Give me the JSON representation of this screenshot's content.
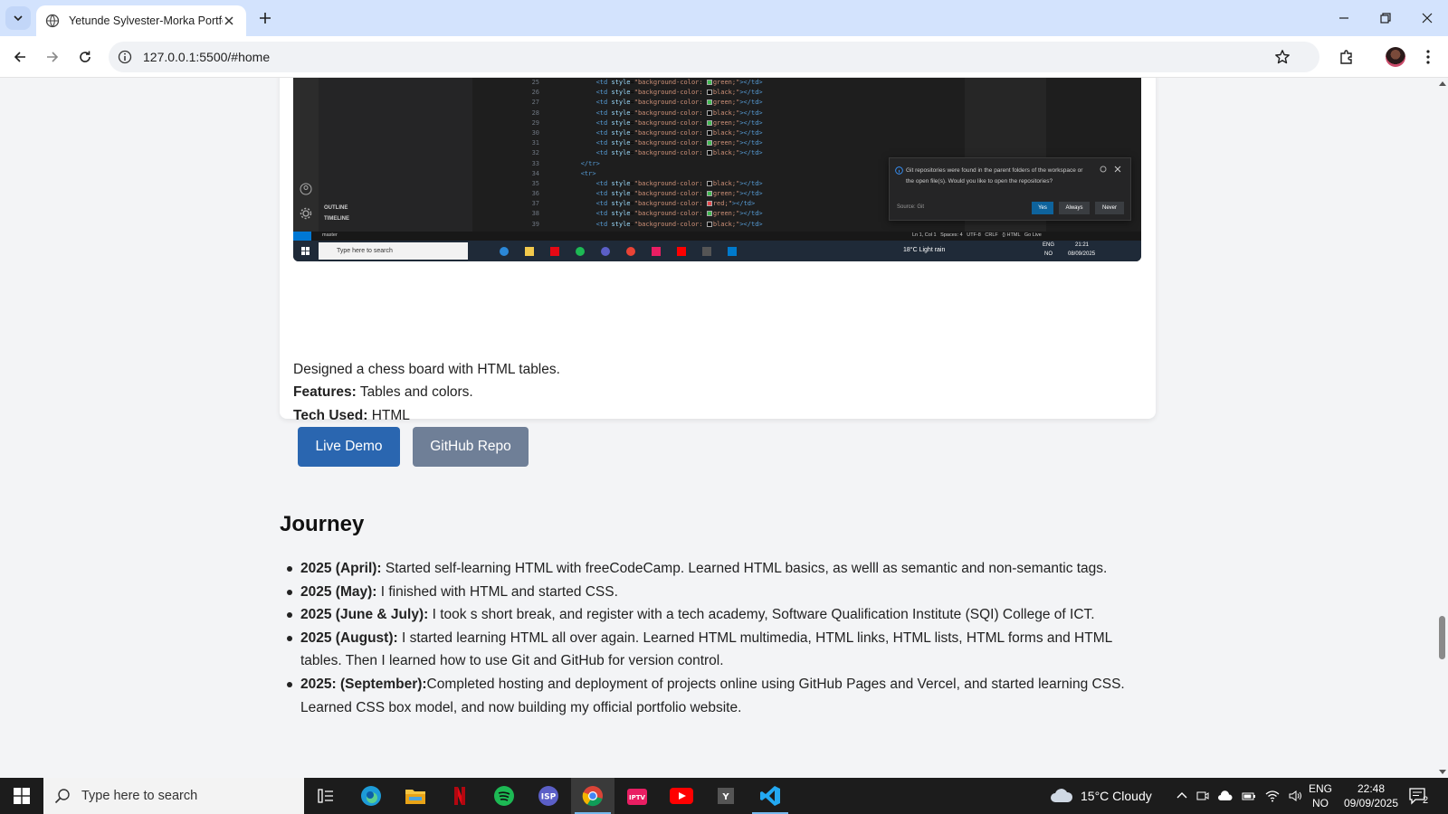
{
  "browser": {
    "tab_title": "Yetunde Sylvester-Morka Portfolio",
    "url": "127.0.0.1:5500/#home"
  },
  "project": {
    "description": "Designed a chess board with HTML tables.",
    "features_label": "Features:",
    "features_value": "Tables and colors.",
    "tech_label": "Tech Used:",
    "tech_value": "HTML",
    "live_demo_label": "Live Demo",
    "github_repo_label": "GitHub Repo"
  },
  "embedded_screenshot": {
    "code_lines": [
      {
        "n": "25",
        "color": "green",
        "sw": "#3fb950"
      },
      {
        "n": "26",
        "color": "black",
        "sw": "#000000"
      },
      {
        "n": "27",
        "color": "green",
        "sw": "#3fb950"
      },
      {
        "n": "28",
        "color": "black",
        "sw": "#000000"
      },
      {
        "n": "29",
        "color": "green",
        "sw": "#3fb950"
      },
      {
        "n": "30",
        "color": "black",
        "sw": "#000000"
      },
      {
        "n": "31",
        "color": "green",
        "sw": "#3fb950"
      },
      {
        "n": "32",
        "color": "black",
        "sw": "#000000"
      }
    ],
    "code_lines_2": [
      {
        "n": "35",
        "color": "black",
        "sw": "#000000"
      },
      {
        "n": "36",
        "color": "green",
        "sw": "#3fb950"
      },
      {
        "n": "37",
        "color": "red",
        "sw": "#e5484d"
      },
      {
        "n": "38",
        "color": "green",
        "sw": "#3fb950"
      },
      {
        "n": "39",
        "color": "black",
        "sw": "#000000"
      }
    ],
    "outline": "OUTLINE",
    "timeline": "TIMELINE",
    "notification": "Git repositories were found in the parent folders of the workspace or the open file(s). Would you like to open the repositories?",
    "notification_source": "Source: Git",
    "btn_yes": "Yes",
    "btn_always": "Always",
    "btn_never": "Never",
    "status_branch": "master",
    "status_right": "Ln 1, Col 1   Spaces: 4   UTF-8   CRLF   {} HTML   Go Live",
    "taskbar_search": "Type here to search",
    "weather": "18°C  Light rain",
    "lang": "ENG",
    "lang2": "NO",
    "time": "21:21",
    "date": "08/09/2025"
  },
  "journey": {
    "title": "Journey",
    "items": [
      {
        "label": "2025 (April):",
        "text": " Started self-learning HTML with freeCodeCamp. Learned HTML basics, as welll as semantic and non-semantic tags."
      },
      {
        "label": "2025 (May):",
        "text": " I finished with HTML and started CSS."
      },
      {
        "label": "2025 (June & July):",
        "text": " I took s short break, and register with a tech academy, Software Qualification Institute (SQI) College of ICT."
      },
      {
        "label": "2025 (August):",
        "text": " I started learning HTML all over again. Learned HTML multimedia, HTML links, HTML lists, HTML forms and HTML tables. Then I learned how to use Git and GitHub for version control."
      },
      {
        "label": "2025: (September):",
        "text": "Completed hosting and deployment of projects online using GitHub Pages and Vercel, and started learning CSS. Learned CSS box model, and now building my official portfolio website."
      }
    ]
  },
  "taskbar": {
    "search_placeholder": "Type here to search",
    "weather": "15°C  Cloudy",
    "lang_top": "ENG",
    "lang_bottom": "NO",
    "time": "22:48",
    "date": "09/09/2025",
    "notification_count": "2"
  },
  "colors": {
    "live_demo": "#2a66b0",
    "github_repo": "#6f7f97",
    "tabbar": "#d3e3fd"
  }
}
